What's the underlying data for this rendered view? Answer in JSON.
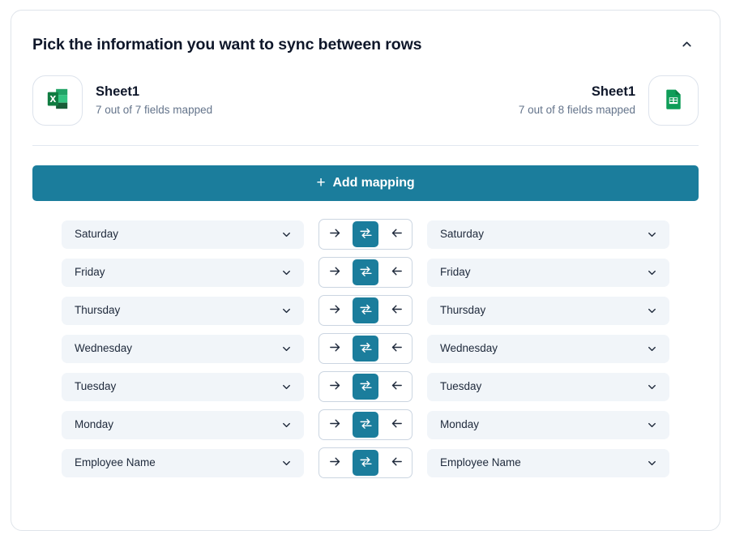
{
  "header": {
    "title": "Pick the information you want to sync between rows",
    "collapse_icon": "chevron-up-icon"
  },
  "source_app": {
    "icon": "microsoft-excel-icon",
    "name": "Sheet1",
    "fields_mapped": "7 out of 7 fields mapped"
  },
  "target_app": {
    "icon": "google-sheets-icon",
    "name": "Sheet1",
    "fields_mapped": "7 out of 8 fields mapped"
  },
  "add_mapping": {
    "label": "Add mapping",
    "plus": "+",
    "color": "#1b7d9c"
  },
  "direction": {
    "right_icon": "→",
    "both_icon": "⇄",
    "left_icon": "←"
  },
  "chevron_down": "⌄",
  "mappings": [
    {
      "left": "Saturday",
      "right": "Saturday",
      "direction": "both"
    },
    {
      "left": "Friday",
      "right": "Friday",
      "direction": "both"
    },
    {
      "left": "Thursday",
      "right": "Thursday",
      "direction": "both"
    },
    {
      "left": "Wednesday",
      "right": "Wednesday",
      "direction": "both"
    },
    {
      "left": "Tuesday",
      "right": "Tuesday",
      "direction": "both"
    },
    {
      "left": "Monday",
      "right": "Monday",
      "direction": "both"
    },
    {
      "left": "Employee Name",
      "right": "Employee Name",
      "direction": "both"
    }
  ],
  "colors": {
    "accent": "#1b7d9c",
    "field_bg": "#f1f5f9",
    "text": "#0f172a",
    "muted": "#64748b",
    "border": "#dfe4ea"
  }
}
